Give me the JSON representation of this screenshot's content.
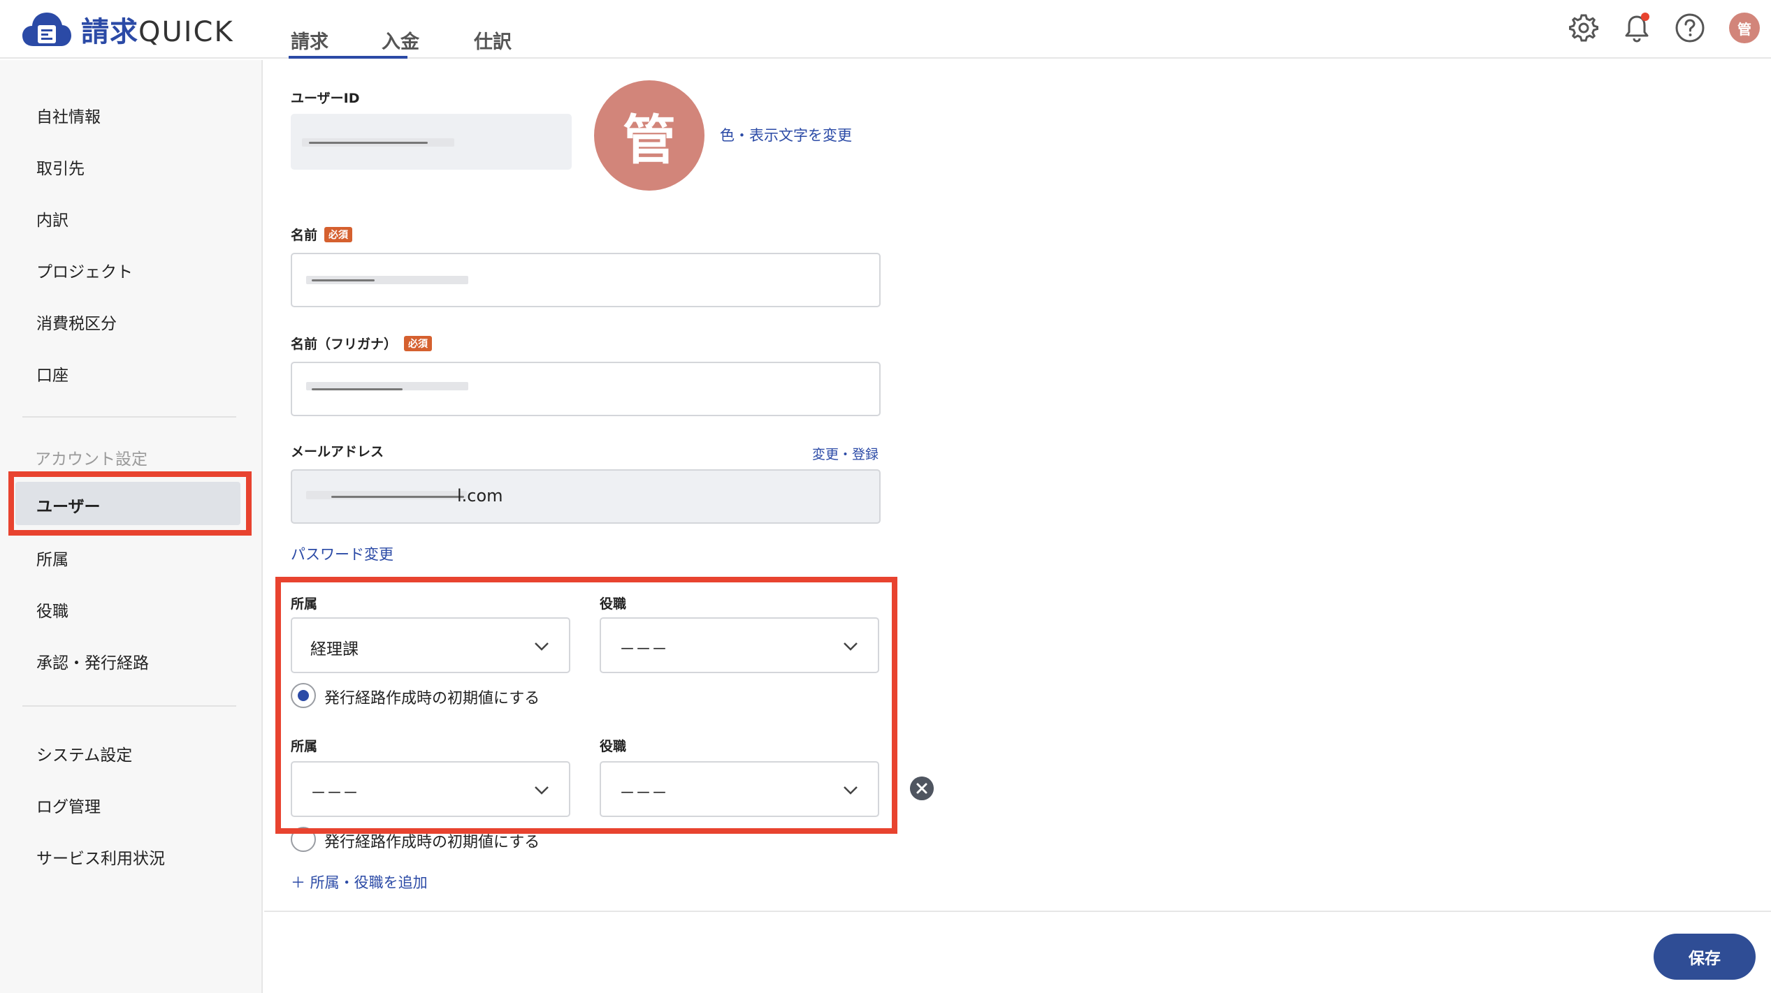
{
  "app": {
    "logo_text": "請求",
    "logo_text_latin": "QUICK"
  },
  "header": {
    "tabs": [
      {
        "label": "請求",
        "active": true
      },
      {
        "label": "入金",
        "active": false
      },
      {
        "label": "仕訳",
        "active": false
      }
    ],
    "icons": [
      "gear-icon",
      "bell-icon",
      "help-icon"
    ],
    "avatar_char": "管",
    "notification_dot_color": "#e8432f"
  },
  "sidebar": {
    "items": [
      {
        "label": "自社情報"
      },
      {
        "label": "取引先"
      },
      {
        "label": "内訳"
      },
      {
        "label": "プロジェクト"
      },
      {
        "label": "消費税区分"
      },
      {
        "label": "口座"
      }
    ],
    "account_section_title": "アカウント設定",
    "account_items": [
      {
        "label": "ユーザー",
        "active": true
      },
      {
        "label": "所属"
      },
      {
        "label": "役職"
      },
      {
        "label": "承認・発行経路"
      }
    ],
    "system_items": [
      {
        "label": "システム設定"
      },
      {
        "label": "ログ管理"
      },
      {
        "label": "サービス利用状況"
      }
    ]
  },
  "form": {
    "user_id_label": "ユーザーID",
    "avatar_char": "管",
    "avatar_color": "#d2857a",
    "change_color_link": "色・表示文字を変更",
    "name_label": "名前",
    "required_badge": "必須",
    "kana_label": "名前（フリガナ）",
    "email_label": "メールアドレス",
    "email_change_link": "変更・登録",
    "email_value_suffix": "l.com",
    "password_link": "パスワード変更",
    "assignments": [
      {
        "dept_label": "所属",
        "dept_value": "経理課",
        "role_label": "役職",
        "role_value": "－－－",
        "default_label": "発行経路作成時の初期値にする",
        "default_checked": true
      },
      {
        "dept_label": "所属",
        "dept_value": "－－－",
        "role_label": "役職",
        "role_value": "－－－",
        "default_label": "発行経路作成時の初期値にする",
        "default_checked": false
      }
    ],
    "add_assignment_link": "＋ 所属・役職を追加",
    "save_label": "保存"
  },
  "colors": {
    "accent": "#2b4aa6",
    "highlight_border": "#e8432f",
    "save_button": "#2f4d95"
  }
}
